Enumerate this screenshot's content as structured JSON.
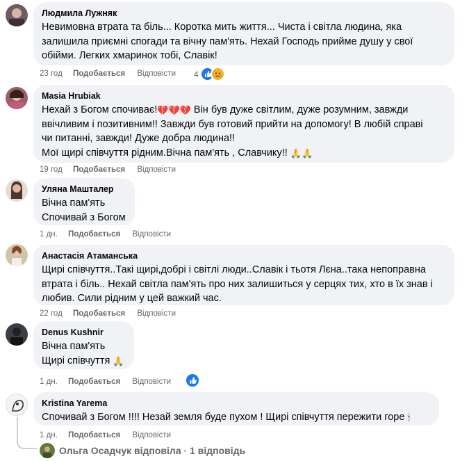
{
  "comments": [
    {
      "author": "Людмила Лужняк",
      "text": "Невимовна втрата та біль... Коротка мить життя... Чиста і світла людина, яка\nзалишила приємні спогади та вічну пам'ять. Нехай Господь прийме душу у свої\nобійми. Легких хмаринок тобі, Славік!",
      "time": "23 год",
      "like": "Подобається",
      "reply": "Відповісти",
      "reaction_count": "4"
    },
    {
      "author": "Masia Hrubiak",
      "text_parts": [
        "Нехай з Богом спочиває!",
        "💔💔💔",
        " Він був дуже світлим, дуже розумним, завжди\nввічливим і позитивним!! Завжди був готовий прийти на допомогу! В любій справі\nчи питанні, завжди! Дуже добра людина!!\nМої щирі співчуття рідним.Вічна пам'ять , Славчику!! ",
        "🙏🙏"
      ],
      "time": "19 год",
      "like": "Подобається",
      "reply": "Відповісти"
    },
    {
      "author": "Уляна Машталер",
      "text": "Вічна пам'ять\nСпочивай з Богом",
      "time": "1 дн.",
      "like": "Подобається",
      "reply": "Відповісти"
    },
    {
      "author": "Анастасія Атаманська",
      "text": "Щирі співчуття..Такі щирі,добрі і світлі люди..Славік і тьотя Лєна..така непоправна\nвтрата і біль.. Нехай світла пам'ять про них залишиться у серцях тих, хто в їх знав і\nлюбив. Сили рідним у цей важкий час.",
      "time": "22 год",
      "like": "Подобається",
      "reply": "Відповісти"
    },
    {
      "author": "Denus Kushnir",
      "text_parts": [
        "Вічна пам'ять\nЩирі співчуття ",
        "🙏"
      ],
      "time": "1 дн.",
      "like": "Подобається",
      "reply": "Відповісти"
    },
    {
      "author": "Kristina Yarema",
      "text_parts": [
        "Спочивай з Богом !!!! Незай земля буде пухом ! Щирі співчуття пережити горе ",
        "🕯"
      ],
      "time": "1 дн.",
      "like": "Подобається",
      "reply": "Відповісти"
    }
  ],
  "reply_summary": "Ольга Осадчук відповіла · 1 відповідь",
  "colors": {
    "bubble": "#f0f2f5",
    "secondary_text": "#65676b",
    "like_blue": "#1877f2",
    "sad_yellow": "#f7b125"
  },
  "icons": [
    "like-icon",
    "sad-icon",
    "heart-broken-icon",
    "praying-hands-icon",
    "candle-icon"
  ]
}
